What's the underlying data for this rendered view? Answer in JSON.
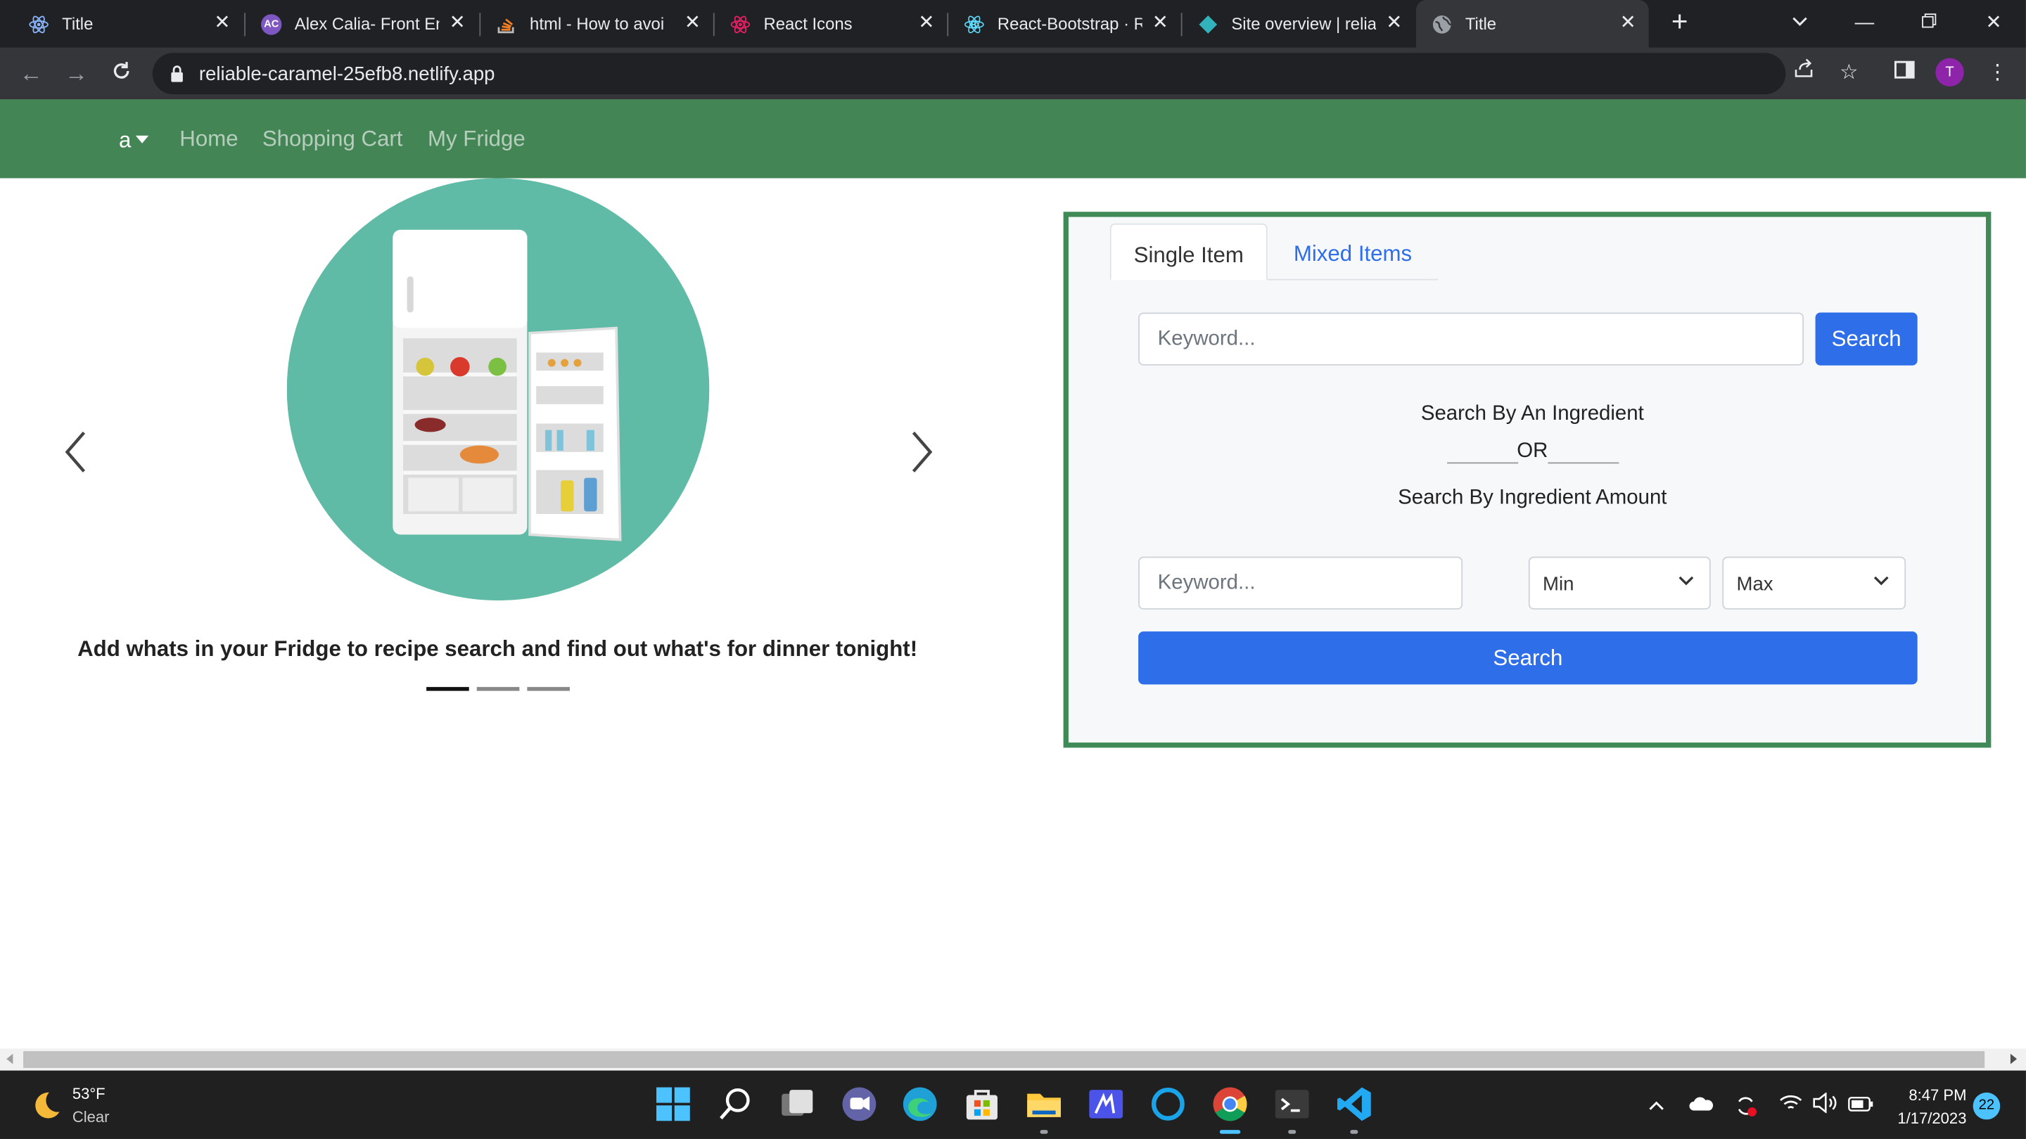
{
  "browser": {
    "tabs": [
      {
        "title": "Title",
        "icon": "react-icon"
      },
      {
        "title": "Alex Calia- Front En",
        "icon": "ac-icon"
      },
      {
        "title": "html - How to avoi",
        "icon": "stackoverflow-icon"
      },
      {
        "title": "React Icons",
        "icon": "react-icon"
      },
      {
        "title": "React-Bootstrap · R",
        "icon": "react-bootstrap-icon"
      },
      {
        "title": "Site overview | relia",
        "icon": "netlify-icon"
      },
      {
        "title": "Title",
        "icon": "globe-icon"
      }
    ],
    "url": "reliable-caramel-25efb8.netlify.app",
    "profile_initial": "T"
  },
  "navbar": {
    "dropdown_label": "a",
    "links": [
      "Home",
      "Shopping Cart",
      "My Fridge"
    ],
    "bg_color": "#448556"
  },
  "carousel": {
    "caption": "Add whats in your Fridge to recipe search and find out what's for dinner tonight!",
    "indicators": 3,
    "active_index": 0
  },
  "search_panel": {
    "tabs": [
      "Single Item",
      "Mixed Items"
    ],
    "active_tab": "Single Item",
    "keyword_placeholder": "Keyword...",
    "search_label": "Search",
    "line1": "Search By An Ingredient",
    "or_text": "OR",
    "line2": "Search By Ingredient Amount",
    "amount_keyword_placeholder": "Keyword...",
    "min_label": "Min",
    "max_label": "Max",
    "search_full_label": "Search",
    "accent_color": "#2f6ee9",
    "border_color": "#3f8a56"
  },
  "taskbar": {
    "weather_temp": "53°F",
    "weather_cond": "Clear",
    "time": "8:47 PM",
    "date": "1/17/2023",
    "notifications": "22"
  }
}
